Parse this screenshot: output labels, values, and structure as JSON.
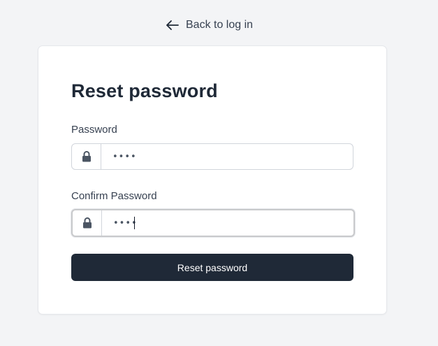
{
  "back_link": {
    "label": "Back to log in",
    "icon": "arrow-left-icon"
  },
  "form": {
    "title": "Reset password",
    "password": {
      "label": "Password",
      "value": "••••",
      "icon": "lock-icon"
    },
    "confirm_password": {
      "label": "Confirm Password",
      "value": "••••",
      "icon": "lock-icon",
      "focused": true
    },
    "submit_label": "Reset password"
  },
  "colors": {
    "background": "#f3f4f6",
    "card": "#ffffff",
    "primary_button": "#1f2937",
    "text": "#1f2937"
  }
}
